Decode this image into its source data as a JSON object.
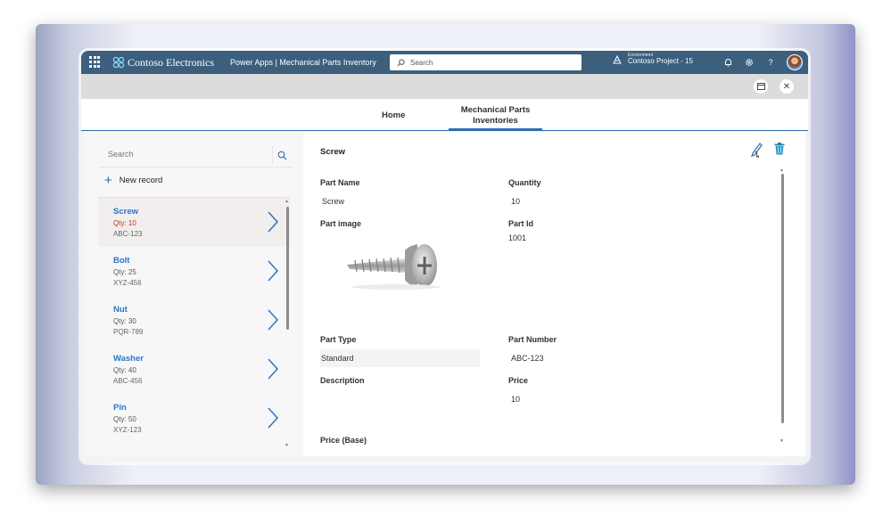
{
  "topbar": {
    "brand": "Contoso Electronics",
    "app_title": "Power Apps  |  Mechanical Parts Inventory",
    "search_placeholder": "Search",
    "environment_label": "Environment",
    "environment_name": "Contoso Project - 15"
  },
  "tabs": [
    {
      "label": "Home"
    },
    {
      "label": "Mechanical Parts Inventories"
    }
  ],
  "list": {
    "search_placeholder": "Search",
    "new_record_label": "New record",
    "items": [
      {
        "name": "Screw",
        "qty": "Qty: 10",
        "code": "ABC-123"
      },
      {
        "name": "Bolt",
        "qty": "Qty: 25",
        "code": "XYZ-456"
      },
      {
        "name": "Nut",
        "qty": "Qty: 30",
        "code": "PQR-789"
      },
      {
        "name": "Washer",
        "qty": "Qty: 40",
        "code": "ABC-456"
      },
      {
        "name": "Pin",
        "qty": "Qty: 50",
        "code": "XYZ-123"
      }
    ]
  },
  "detail": {
    "title": "Screw",
    "part_name_label": "Part Name",
    "part_name_value": "Screw",
    "quantity_label": "Quantity",
    "quantity_value": "10",
    "part_image_label": "Part image",
    "part_id_label": "Part Id",
    "part_id_value": "1001",
    "part_type_label": "Part Type",
    "part_type_value": "Standard",
    "part_number_label": "Part Number",
    "part_number_value": "ABC-123",
    "description_label": "Description",
    "price_label": "Price",
    "price_value": "10",
    "price_base_label": "Price (Base)"
  },
  "colors": {
    "topbar": "#3b5f7d",
    "accent": "#2a6fb0",
    "link": "#2a74c8",
    "selected_qty": "#b53a1f"
  },
  "icons": [
    "waffle-icon",
    "contoso-logo-icon",
    "search-icon",
    "environment-icon",
    "bell-icon",
    "gear-icon",
    "help-icon",
    "avatar",
    "restore-icon",
    "close-icon",
    "plus-icon",
    "chevron-right-icon",
    "edit-icon",
    "delete-icon"
  ]
}
